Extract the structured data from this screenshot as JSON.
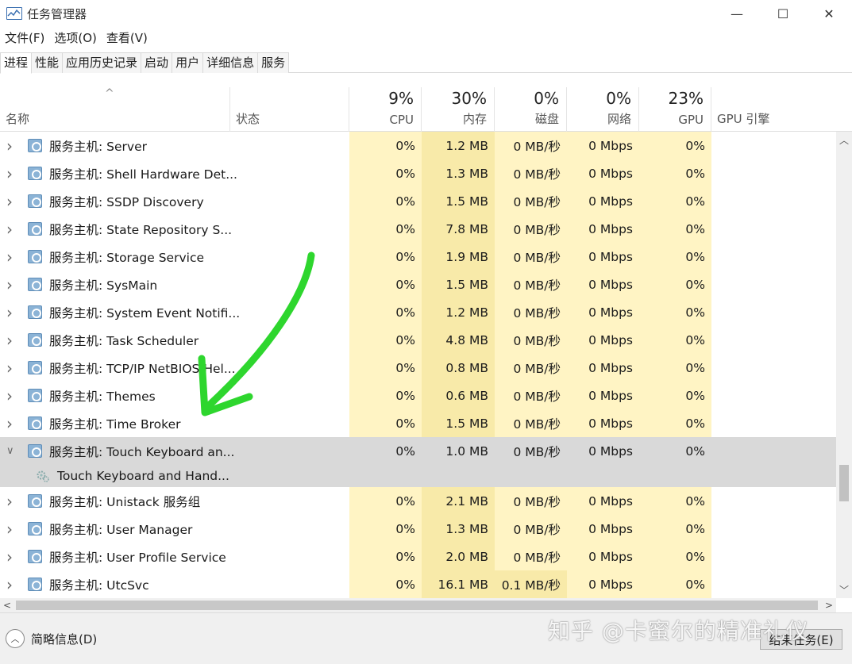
{
  "window": {
    "title": "任务管理器",
    "minimize_label": "—",
    "maximize_label": "☐",
    "close_label": "✕"
  },
  "menu": [
    "文件(F)",
    "选项(O)",
    "查看(V)"
  ],
  "tabs": [
    "进程",
    "性能",
    "应用历史记录",
    "启动",
    "用户",
    "详细信息",
    "服务"
  ],
  "active_tab": "进程",
  "header": {
    "sort_arrow": "^",
    "name_label": "名称",
    "status_label": "状态",
    "cpu": {
      "pct": "9%",
      "label": "CPU"
    },
    "memory": {
      "pct": "30%",
      "label": "内存"
    },
    "disk": {
      "pct": "0%",
      "label": "磁盘"
    },
    "network": {
      "pct": "0%",
      "label": "网络"
    },
    "gpu": {
      "pct": "23%",
      "label": "GPU"
    },
    "gpu_engine_label": "GPU 引擎"
  },
  "rows": [
    {
      "name": "服务主机: Server",
      "cpu": "0%",
      "mem": "1.2 MB",
      "disk": "0 MB/秒",
      "net": "0 Mbps",
      "gpu": "0%",
      "expanded": false
    },
    {
      "name": "服务主机: Shell Hardware Det...",
      "cpu": "0%",
      "mem": "1.3 MB",
      "disk": "0 MB/秒",
      "net": "0 Mbps",
      "gpu": "0%",
      "expanded": false
    },
    {
      "name": "服务主机: SSDP Discovery",
      "cpu": "0%",
      "mem": "1.5 MB",
      "disk": "0 MB/秒",
      "net": "0 Mbps",
      "gpu": "0%",
      "expanded": false
    },
    {
      "name": "服务主机: State Repository S...",
      "cpu": "0%",
      "mem": "7.8 MB",
      "disk": "0 MB/秒",
      "net": "0 Mbps",
      "gpu": "0%",
      "expanded": false
    },
    {
      "name": "服务主机: Storage Service",
      "cpu": "0%",
      "mem": "1.9 MB",
      "disk": "0 MB/秒",
      "net": "0 Mbps",
      "gpu": "0%",
      "expanded": false
    },
    {
      "name": "服务主机: SysMain",
      "cpu": "0%",
      "mem": "1.5 MB",
      "disk": "0 MB/秒",
      "net": "0 Mbps",
      "gpu": "0%",
      "expanded": false
    },
    {
      "name": "服务主机: System Event Notifi...",
      "cpu": "0%",
      "mem": "1.2 MB",
      "disk": "0 MB/秒",
      "net": "0 Mbps",
      "gpu": "0%",
      "expanded": false
    },
    {
      "name": "服务主机: Task Scheduler",
      "cpu": "0%",
      "mem": "4.8 MB",
      "disk": "0 MB/秒",
      "net": "0 Mbps",
      "gpu": "0%",
      "expanded": false
    },
    {
      "name": "服务主机: TCP/IP NetBIOS Hel...",
      "cpu": "0%",
      "mem": "0.8 MB",
      "disk": "0 MB/秒",
      "net": "0 Mbps",
      "gpu": "0%",
      "expanded": false
    },
    {
      "name": "服务主机: Themes",
      "cpu": "0%",
      "mem": "0.6 MB",
      "disk": "0 MB/秒",
      "net": "0 Mbps",
      "gpu": "0%",
      "expanded": false
    },
    {
      "name": "服务主机: Time Broker",
      "cpu": "0%",
      "mem": "1.5 MB",
      "disk": "0 MB/秒",
      "net": "0 Mbps",
      "gpu": "0%",
      "expanded": false
    },
    {
      "name": "服务主机: Touch Keyboard an...",
      "cpu": "0%",
      "mem": "1.0 MB",
      "disk": "0 MB/秒",
      "net": "0 Mbps",
      "gpu": "0%",
      "expanded": true,
      "selected": true
    },
    {
      "name": "Touch Keyboard and Hand...",
      "sub": true,
      "selected": true
    },
    {
      "name": "服务主机: Unistack 服务组",
      "cpu": "0%",
      "mem": "2.1 MB",
      "disk": "0 MB/秒",
      "net": "0 Mbps",
      "gpu": "0%",
      "expanded": false
    },
    {
      "name": "服务主机: User Manager",
      "cpu": "0%",
      "mem": "1.3 MB",
      "disk": "0 MB/秒",
      "net": "0 Mbps",
      "gpu": "0%",
      "expanded": false
    },
    {
      "name": "服务主机: User Profile Service",
      "cpu": "0%",
      "mem": "2.0 MB",
      "disk": "0 MB/秒",
      "net": "0 Mbps",
      "gpu": "0%",
      "expanded": false
    },
    {
      "name": "服务主机: UtcSvc",
      "cpu": "0%",
      "mem": "16.1 MB",
      "disk": "0.1 MB/秒",
      "net": "0 Mbps",
      "gpu": "0%",
      "expanded": false,
      "disk_active": true
    }
  ],
  "footer": {
    "fewer_details": "简略信息(D)",
    "end_task": "结束任务(E)"
  },
  "watermark": "知乎 @卡蜜尔的精准礼仪",
  "colors": {
    "heat_light": "#fff4c4",
    "heat_mid": "#f8eaa9",
    "selected_row": "#d9d9d9",
    "annotation_arrow": "#2ed62e"
  }
}
